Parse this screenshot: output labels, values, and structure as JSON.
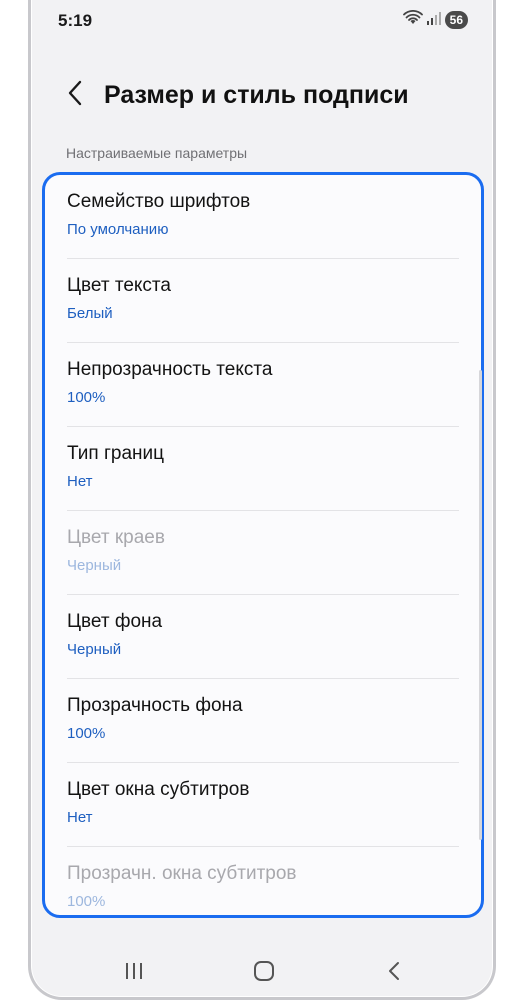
{
  "status_bar": {
    "time": "5:19",
    "battery": "56",
    "icons": [
      "wifi-icon",
      "signal-icon"
    ]
  },
  "header": {
    "title": "Размер и стиль подписи",
    "back_icon": "chevron-left-icon"
  },
  "section": {
    "label": "Настраиваемые параметры"
  },
  "settings": [
    {
      "title": "Семейство шрифтов",
      "value": "По умолчанию",
      "enabled": true
    },
    {
      "title": "Цвет текста",
      "value": "Белый",
      "enabled": true
    },
    {
      "title": "Непрозрачность текста",
      "value": "100%",
      "enabled": true
    },
    {
      "title": "Тип границ",
      "value": "Нет",
      "enabled": true
    },
    {
      "title": "Цвет краев",
      "value": "Черный",
      "enabled": false
    },
    {
      "title": "Цвет фона",
      "value": "Черный",
      "enabled": true
    },
    {
      "title": "Прозрачность фона",
      "value": "100%",
      "enabled": true
    },
    {
      "title": "Цвет окна субтитров",
      "value": "Нет",
      "enabled": true
    },
    {
      "title": "Прозрачн. окна субтитров",
      "value": "100%",
      "enabled": false
    }
  ],
  "nav_bar": {
    "icons": [
      "recents-icon",
      "home-icon",
      "back-icon"
    ]
  },
  "colors": {
    "accent": "#1e5fc0",
    "highlight_border": "#1a6cf0",
    "background": "#f2f2f4"
  }
}
